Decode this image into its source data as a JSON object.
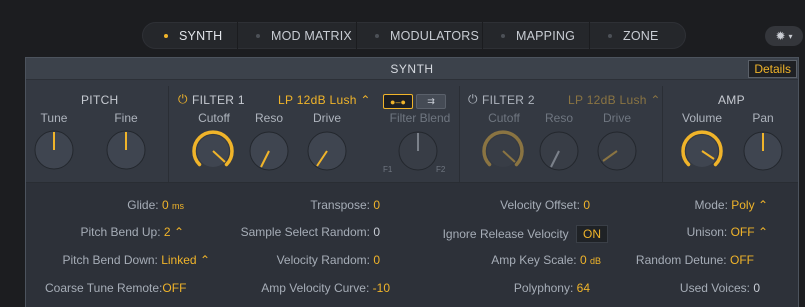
{
  "tabs": [
    {
      "label": "SYNTH",
      "active": true
    },
    {
      "label": "MOD MATRIX",
      "active": false
    },
    {
      "label": "MODULATORS",
      "active": false
    },
    {
      "label": "MAPPING",
      "active": false
    },
    {
      "label": "ZONE",
      "active": false
    }
  ],
  "gear_icon": "gear-icon",
  "panel": {
    "title": "SYNTH",
    "details_label": "Details"
  },
  "pitch": {
    "title": "PITCH",
    "tune_label": "Tune",
    "fine_label": "Fine"
  },
  "filter1": {
    "title": "FILTER 1",
    "type": "LP 12dB Lush",
    "cutoff_label": "Cutoff",
    "reso_label": "Reso",
    "drive_label": "Drive"
  },
  "filter_blend": {
    "label": "Filter Blend",
    "left": "F1",
    "right": "F2"
  },
  "filter2": {
    "title": "FILTER 2",
    "type": "LP 12dB Lush",
    "cutoff_label": "Cutoff",
    "reso_label": "Reso",
    "drive_label": "Drive"
  },
  "amp": {
    "title": "AMP",
    "volume_label": "Volume",
    "pan_label": "Pan"
  },
  "params": {
    "glide": {
      "label": "Glide:",
      "value": "0",
      "unit": "ms"
    },
    "transpose": {
      "label": "Transpose:",
      "value": "0"
    },
    "velocity_offset": {
      "label": "Velocity Offset:",
      "value": "0"
    },
    "mode": {
      "label": "Mode:",
      "value": "Poly"
    },
    "pitch_bend_up": {
      "label": "Pitch Bend Up:",
      "value": "2"
    },
    "sample_select_random": {
      "label": "Sample Select Random:",
      "value": "0"
    },
    "ignore_release_velocity": {
      "label": "Ignore Release Velocity",
      "value": "ON"
    },
    "unison": {
      "label": "Unison:",
      "value": "OFF"
    },
    "pitch_bend_down": {
      "label": "Pitch Bend Down:",
      "value": "Linked"
    },
    "velocity_random": {
      "label": "Velocity Random:",
      "value": "0"
    },
    "amp_key_scale": {
      "label": "Amp Key Scale:",
      "value": "0",
      "unit": "dB"
    },
    "random_detune": {
      "label": "Random Detune:",
      "value": "OFF"
    },
    "coarse_tune_remote": {
      "label": "Coarse Tune Remote:",
      "value": "OFF"
    },
    "amp_velocity_curve": {
      "label": "Amp Velocity Curve:",
      "value": "-10"
    },
    "polyphony": {
      "label": "Polyphony:",
      "value": "64"
    },
    "used_voices": {
      "label": "Used Voices:",
      "value": "0"
    }
  },
  "colors": {
    "accent": "#f0b42a",
    "accent_dim": "#8a7442",
    "panel": "#363b43",
    "background": "#1c1d20"
  }
}
